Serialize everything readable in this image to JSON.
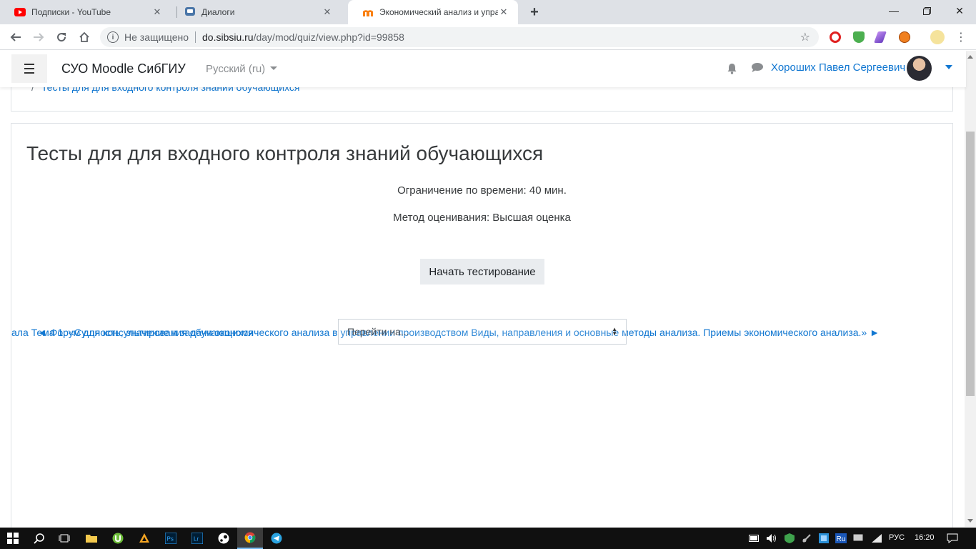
{
  "browser": {
    "tabs": [
      {
        "title": "Подписки - YouTube",
        "icon": "youtube-icon"
      },
      {
        "title": "Диалоги",
        "icon": "vk-messages-icon"
      },
      {
        "title": "Экономический анализ и управ",
        "icon": "moodle-icon"
      }
    ],
    "close_glyph": "✕",
    "security_label": "Не защищено",
    "url_host": "do.sibsiu.ru",
    "url_path": "/day/mod/quiz/view.php?id=99858"
  },
  "navbar": {
    "brand": "СУО Moodle СибГИУ",
    "language": "Русский (ru)",
    "user_name": "Хороших Павел Сергеевич"
  },
  "breadcrumb": {
    "separator": "/",
    "current": "Тесты для для входного контроля знаний обучающихся"
  },
  "quiz": {
    "title": "Тесты для для входного контроля знаний обучающихся",
    "time_limit": "Ограничение по времени: 40 мин.",
    "grading_method": "Метод оценивания: Высшая оценка",
    "start_button": "Начать тестирование"
  },
  "activity_nav": {
    "prev_link_a": "ала Тема 1. «Сущность, значение и задачи экономического анализа в управлении производством Виды, направления и основные методы анализа. Приемы экономического анализа.» ►",
    "prev_link_b": "◄ Форум для консультирования обучающихся",
    "jump_select_value": "Перейти на..."
  },
  "taskbar": {
    "language": "РУС",
    "time": "16:20"
  },
  "colors": {
    "link": "#1177d1",
    "taskbar": "#101010",
    "tabstrip": "#dee1e6"
  }
}
